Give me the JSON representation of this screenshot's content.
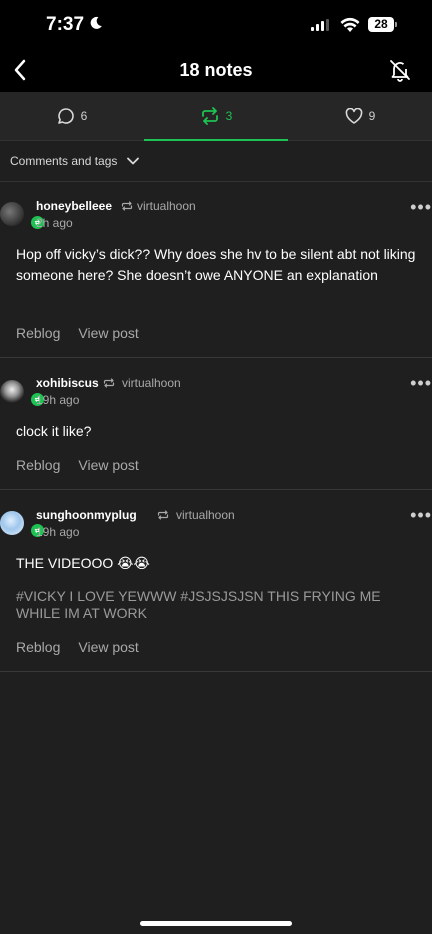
{
  "status_bar": {
    "time": "7:37",
    "battery": "28"
  },
  "nav": {
    "title": "18 notes"
  },
  "tabs": [
    {
      "label": "6",
      "icon": "comment-icon"
    },
    {
      "label": "3",
      "icon": "reblog-icon"
    },
    {
      "label": "9",
      "icon": "heart-icon"
    }
  ],
  "filter": {
    "label": "Comments and tags"
  },
  "notes": [
    {
      "username": "honeybelleee",
      "source": "virtualhoon",
      "time": "2h ago",
      "body": "Hop off vicky’s dick?? Why does she hv to be silent abt not liking someone here? She doesn’t owe ANYONE an explanation",
      "reblog_label": "Reblog",
      "view_label": "View post"
    },
    {
      "username": "xohibiscus",
      "source": "virtualhoon",
      "time": "19h ago",
      "body": "clock it like?",
      "reblog_label": "Reblog",
      "view_label": "View post"
    },
    {
      "username": "sunghoonmyplug",
      "source": "virtualhoon",
      "time": "19h ago",
      "body": "THE VIDEOOO 😭😭",
      "tags": "#VICKY I LOVE YEWWW  #JSJSJSJSN THIS FRYING ME WHILE IM AT WORK",
      "reblog_label": "Reblog",
      "view_label": "View post"
    }
  ],
  "colors": {
    "accent": "#1ec252",
    "background": "#1f1f1f",
    "tabs_bg": "#262626"
  }
}
